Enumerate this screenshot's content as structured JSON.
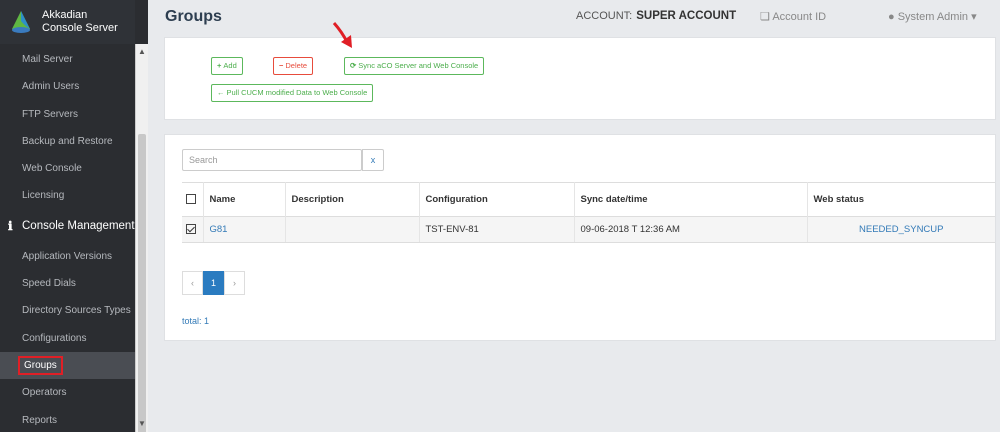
{
  "brand": {
    "line1": "Akkadian",
    "line2": "Console Server"
  },
  "sidebar": {
    "items_top": [
      "Mail Server",
      "Admin Users",
      "FTP Servers",
      "Backup and Restore",
      "Web Console",
      "Licensing"
    ],
    "section": "Console Management",
    "items_bottom": [
      "Application Versions",
      "Speed Dials",
      "Directory Sources Types",
      "Configurations",
      "Groups",
      "Operators",
      "Reports"
    ],
    "active": "Groups"
  },
  "header": {
    "title": "Groups",
    "account_label": "ACCOUNT:",
    "account_value": "SUPER ACCOUNT",
    "account_id": "Account ID",
    "user": "System Admin"
  },
  "toolbar": {
    "add": "Add",
    "delete": "Delete",
    "sync": "Sync aCO Server and Web Console",
    "pull": "Pull CUCM modified Data to Web Console"
  },
  "search": {
    "placeholder": "Search",
    "clear": "x"
  },
  "table": {
    "headers": [
      "Name",
      "Description",
      "Configuration",
      "Sync date/time",
      "Web status"
    ],
    "rows": [
      {
        "checked": true,
        "name": "G81",
        "description": "",
        "configuration": "TST-ENV-81",
        "sync": "09-06-2018 T 12:36 AM",
        "status": "NEEDED_SYNCUP"
      }
    ]
  },
  "pagination": {
    "prev": "‹",
    "current": "1",
    "next": "›"
  },
  "total": "total: 1",
  "colors": {
    "accent": "#2a7bc0",
    "sidebar": "#2b2d31",
    "green": "#5cb85c",
    "red": "#e74c3c",
    "highlight": "#e01f26"
  }
}
